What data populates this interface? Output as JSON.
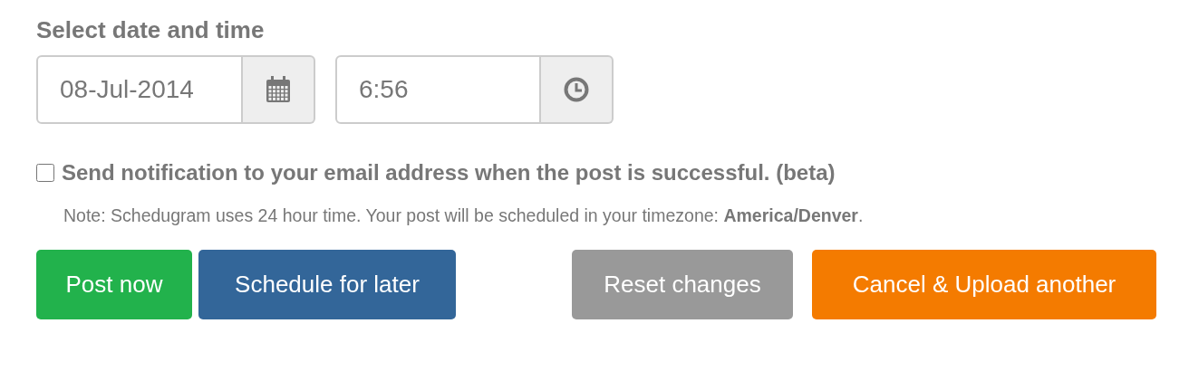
{
  "heading": "Select date and time",
  "date_field": {
    "value": "08-Jul-2014"
  },
  "time_field": {
    "value": "6:56"
  },
  "notify": {
    "label": "Send notification to your email address when the post is successful. (beta)",
    "checked": false
  },
  "note": "Note: Schedugram uses 24 hour time. Your post will be scheduled in your timezone: **America/Denver**.",
  "buttons": [
    {
      "label": "Post now",
      "kind": "success"
    },
    {
      "label": "Schedule for later",
      "kind": "primary"
    },
    {
      "label": "Reset changes",
      "kind": "default"
    },
    {
      "label": "Cancel & Upload another",
      "kind": "warning"
    }
  ]
}
